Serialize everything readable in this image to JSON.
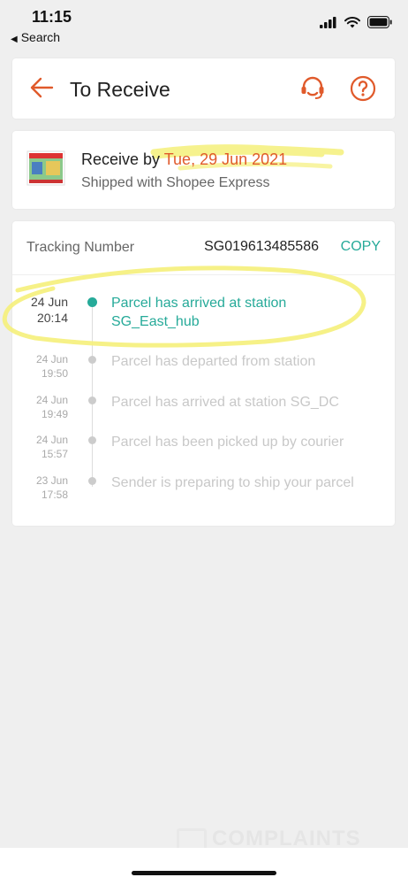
{
  "status_bar": {
    "time": "11:15",
    "back_label": "Search"
  },
  "header": {
    "title": "To Receive"
  },
  "delivery": {
    "receive_prefix": "Receive by ",
    "receive_date": "Tue, 29 Jun 2021",
    "shipped_with": "Shipped with Shopee Express"
  },
  "tracking": {
    "label": "Tracking Number",
    "number": "SG019613485586",
    "copy_label": "COPY",
    "events": [
      {
        "date": "24 Jun",
        "time": "20:14",
        "text": "Parcel has arrived at station SG_East_hub",
        "active": true
      },
      {
        "date": "24 Jun",
        "time": "19:50",
        "text": "Parcel has departed from station",
        "active": false
      },
      {
        "date": "24 Jun",
        "time": "19:49",
        "text": "Parcel has arrived at station SG_DC",
        "active": false
      },
      {
        "date": "24 Jun",
        "time": "15:57",
        "text": "Parcel has been picked up by courier",
        "active": false
      },
      {
        "date": "23 Jun",
        "time": "17:58",
        "text": "Sender is preparing to ship your parcel",
        "active": false
      }
    ]
  },
  "watermark": {
    "text": "COMPLAINTS"
  },
  "colors": {
    "brand": "#e05a2b",
    "accent": "#26aa99",
    "highlight": "#f5f07a"
  },
  "icons": [
    "back-arrow-icon",
    "customer-support-icon",
    "help-icon",
    "cellular-signal-icon",
    "wifi-icon",
    "battery-icon"
  ]
}
